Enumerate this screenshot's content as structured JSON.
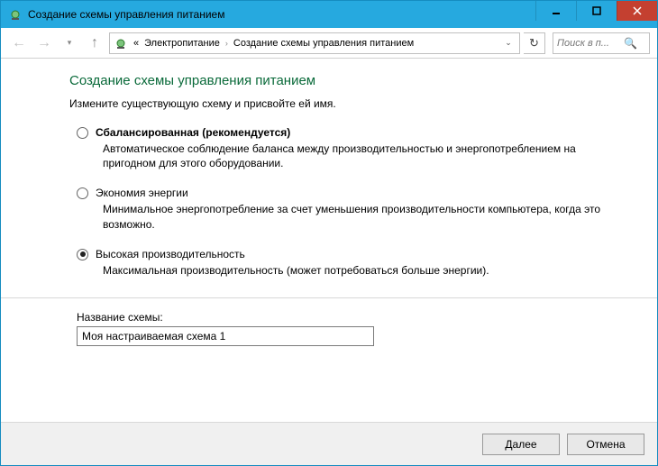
{
  "window": {
    "title": "Создание схемы управления питанием"
  },
  "breadcrumb": {
    "prefix": "«",
    "item1": "Электропитание",
    "item2": "Создание схемы управления питанием"
  },
  "search": {
    "placeholder": "Поиск в п..."
  },
  "content": {
    "heading": "Создание схемы управления питанием",
    "sub": "Измените существующую схему и присвойте ей имя."
  },
  "options": [
    {
      "title": "Сбалансированная (рекомендуется)",
      "desc": "Автоматическое соблюдение баланса между производительностью и энергопотреблением на пригодном для этого оборудовании.",
      "bold": true,
      "selected": false
    },
    {
      "title": "Экономия энергии",
      "desc": "Минимальное энергопотребление за счет уменьшения производительности компьютера, когда это возможно.",
      "bold": false,
      "selected": false
    },
    {
      "title": "Высокая производительность",
      "desc": "Максимальная производительность (может потребоваться больше энергии).",
      "bold": false,
      "selected": true
    }
  ],
  "plan_name": {
    "label": "Название схемы:",
    "value": "Моя настраиваемая схема 1"
  },
  "footer": {
    "next": "Далее",
    "cancel": "Отмена"
  }
}
